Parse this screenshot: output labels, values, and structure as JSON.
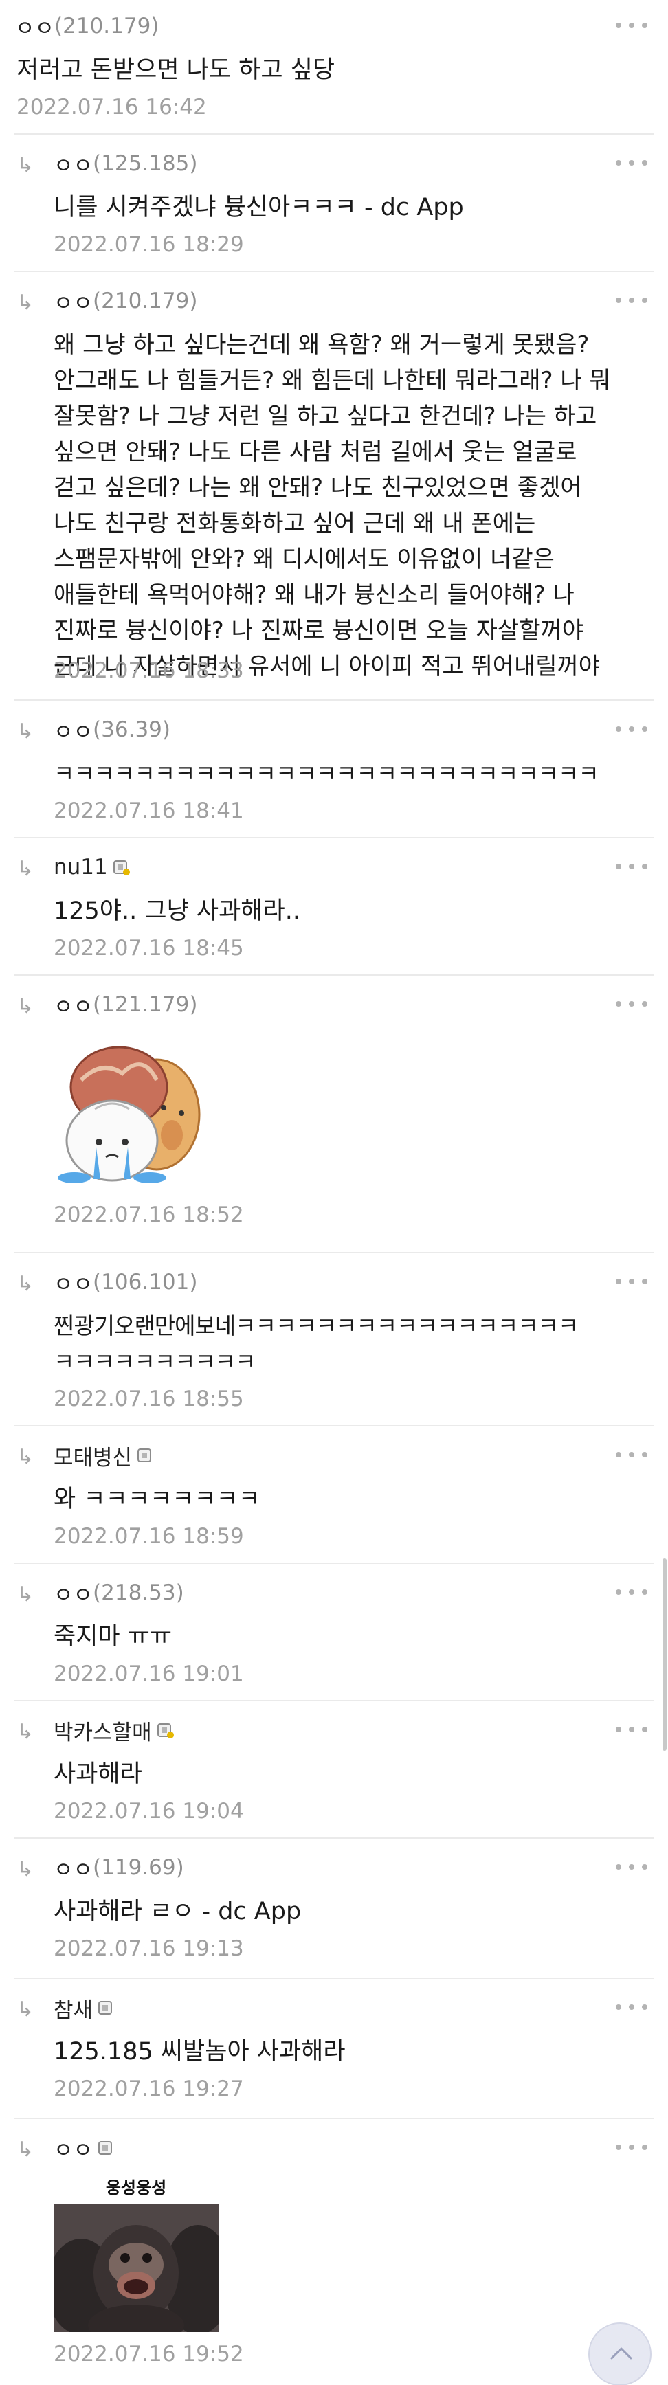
{
  "comments": [
    {
      "nick": "ㅇㅇ",
      "ip": "(210.179)",
      "text": "저러고 돈받으면 나도 하고 싶당",
      "date": "2022.07.16 16:42"
    },
    {
      "nick": "ㅇㅇ",
      "ip": "(125.185)",
      "text": "니를 시켜주겠냐 븅신아ㅋㅋㅋ - dc App",
      "date": "2022.07.16 18:29"
    },
    {
      "nick": "ㅇㅇ",
      "ip": "(210.179)",
      "text": "왜 그냥 하고 싶다는건데 왜 욕함? 왜 거ㅡ렇게 못됐음?\n안그래도 나 힘들거든? 왜 힘든데 나한테 뭐라그래? 나 뭐\n잘못함? 나 그냥 저런 일 하고 싶다고 한건데? 나는 하고\n싶으면 안돼? 나도 다른 사람 처럼 길에서 웃는 얼굴로\n걷고 싶은데? 나는 왜 안돼? 나도 친구있었으면 좋겠어\n나도 친구랑 전화통화하고 싶어 근데 왜 내 폰에는\n스팸문자밖에 안와? 왜 디시에서도 이유없이 너같은\n애들한테 욕먹어야해? 왜 내가 븅신소리 들어야해? 나\n진짜로 븅신이야? 나 진짜로 븅신이면 오늘 자살할꺼야\n근데 나 자살하면서 유서에 니 아이피 적고 뛰어내릴꺼야",
      "date": "2022.07.16 18:33"
    },
    {
      "nick": "ㅇㅇ",
      "ip": "(36.39)",
      "text": "ㅋㅋㅋㅋㅋㅋㅋㅋㅋㅋㅋㅋㅋㅋㅋㅋㅋㅋㅋㅋㅋㅋㅋㅋㅋㅋㅋ",
      "date": "2022.07.16 18:41"
    },
    {
      "nick": "nu11",
      "ip": "",
      "text": "125야.. 그냥 사과해라..",
      "date": "2022.07.16 18:45"
    },
    {
      "nick": "ㅇㅇ",
      "ip": "(121.179)",
      "text": "",
      "date": "2022.07.16 18:52"
    },
    {
      "nick": "ㅇㅇ",
      "ip": "(106.101)",
      "text": "찐광기오랜만에보네ㅋㅋㅋㅋㅋㅋㅋㅋㅋㅋㅋㅋㅋㅋㅋㅋㅋ\nㅋㅋㅋㅋㅋㅋㅋㅋㅋㅋ",
      "date": "2022.07.16 18:55"
    },
    {
      "nick": "모태병신",
      "ip": "",
      "text": "와 ㅋㅋㅋㅋㅋㅋㅋㅋ",
      "date": "2022.07.16 18:59"
    },
    {
      "nick": "ㅇㅇ",
      "ip": "(218.53)",
      "text": "죽지마 ㅠㅠ",
      "date": "2022.07.16 19:01"
    },
    {
      "nick": "박카스할매",
      "ip": "",
      "text": "사과해라",
      "date": "2022.07.16 19:04"
    },
    {
      "nick": "ㅇㅇ",
      "ip": "(119.69)",
      "text": "사과해라 ㄹㅇ - dc App",
      "date": "2022.07.16 19:13"
    },
    {
      "nick": "참새",
      "ip": "",
      "text": "125.185 씨발놈아 사과해라",
      "date": "2022.07.16 19:27"
    },
    {
      "nick": "ㅇㅇ",
      "ip": "",
      "text": "",
      "caption": "웅성웅성",
      "date": "2022.07.16 19:52"
    }
  ],
  "icons": {
    "reply": "reply-arrow-icon",
    "more": "more-options-icon",
    "badge": "user-badge-icon",
    "top": "scroll-to-top-icon"
  },
  "colors": {
    "text": "#222222",
    "meta": "#a0a0a0",
    "divider": "#eaeaea"
  }
}
